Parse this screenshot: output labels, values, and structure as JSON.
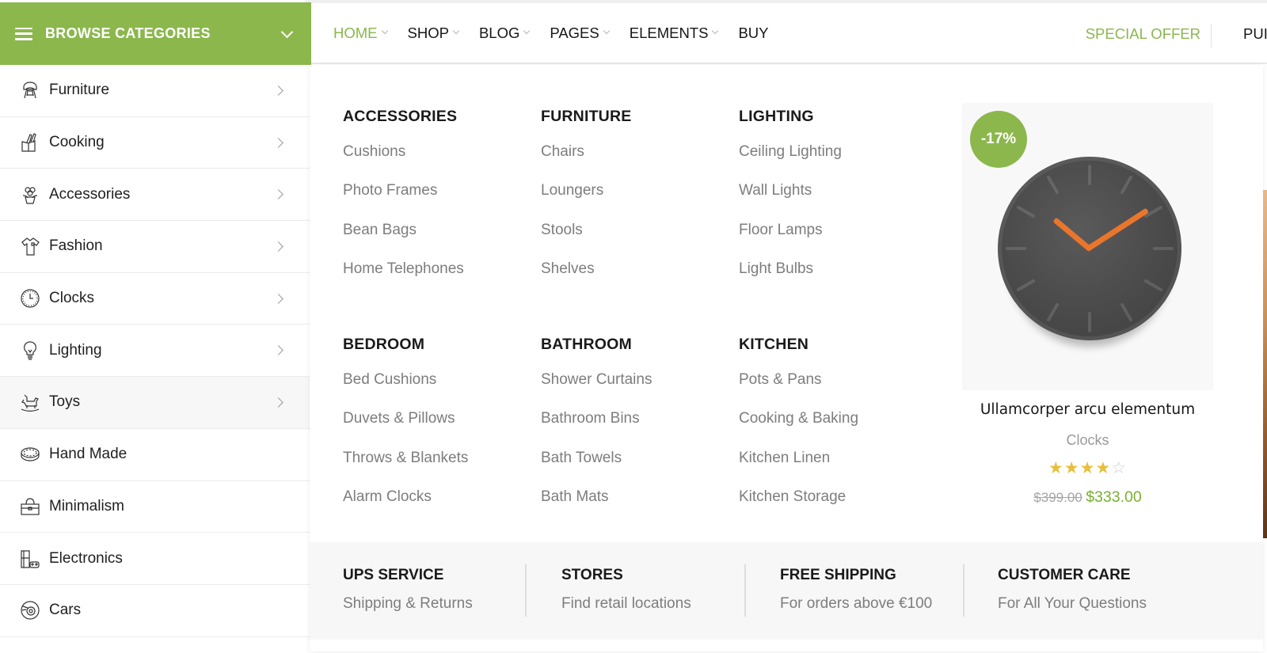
{
  "sidebar": {
    "browse_label": "BROWSE CATEGORIES",
    "categories": [
      {
        "label": "Furniture",
        "icon": "chair-icon",
        "has_submenu": true
      },
      {
        "label": "Cooking",
        "icon": "knife-block-icon",
        "has_submenu": true
      },
      {
        "label": "Accessories",
        "icon": "flower-pot-icon",
        "has_submenu": true
      },
      {
        "label": "Fashion",
        "icon": "shirt-icon",
        "has_submenu": true
      },
      {
        "label": "Clocks",
        "icon": "clock-icon",
        "has_submenu": true
      },
      {
        "label": "Lighting",
        "icon": "light-bulb-icon",
        "has_submenu": true
      },
      {
        "label": "Toys",
        "icon": "rocking-horse-icon",
        "has_submenu": true,
        "active": true
      },
      {
        "label": "Hand Made",
        "icon": "bowl-icon",
        "has_submenu": false
      },
      {
        "label": "Minimalism",
        "icon": "briefcase-icon",
        "has_submenu": false
      },
      {
        "label": "Electronics",
        "icon": "console-icon",
        "has_submenu": false
      },
      {
        "label": "Cars",
        "icon": "wheel-icon",
        "has_submenu": false
      }
    ]
  },
  "nav": {
    "items": [
      {
        "label": "HOME",
        "dropdown": true,
        "active": true
      },
      {
        "label": "SHOP",
        "dropdown": true
      },
      {
        "label": "BLOG",
        "dropdown": true
      },
      {
        "label": "PAGES",
        "dropdown": true
      },
      {
        "label": "ELEMENTS",
        "dropdown": true
      },
      {
        "label": "BUY",
        "dropdown": false
      }
    ],
    "special_offer": "SPECIAL OFFER",
    "purchase_partial": "PUI"
  },
  "mega_menu": {
    "columns": [
      {
        "title": "ACCESSORIES",
        "links": [
          "Cushions",
          "Photo Frames",
          "Bean Bags",
          "Home Telephones"
        ]
      },
      {
        "title": "FURNITURE",
        "links": [
          "Chairs",
          "Loungers",
          "Stools",
          "Shelves"
        ]
      },
      {
        "title": "LIGHTING",
        "links": [
          "Ceiling Lighting",
          "Wall Lights",
          "Floor Lamps",
          "Light Bulbs"
        ]
      },
      {
        "title": "BEDROOM",
        "links": [
          "Bed Cushions",
          "Duvets & Pillows",
          "Throws & Blankets",
          "Alarm Clocks"
        ]
      },
      {
        "title": "BATHROOM",
        "links": [
          "Shower Curtains",
          "Bathroom Bins",
          "Bath Towels",
          "Bath Mats"
        ]
      },
      {
        "title": "KITCHEN",
        "links": [
          "Pots & Pans",
          "Cooking & Baking",
          "Kitchen Linen",
          "Kitchen Storage"
        ]
      }
    ],
    "product": {
      "badge": "-17%",
      "name": "Ullamcorper arcu elementum",
      "category": "Clocks",
      "rating": 4,
      "rating_max": 5,
      "old_price": "$399.00",
      "new_price": "$333.00"
    },
    "features": [
      {
        "title": "UPS SERVICE",
        "subtitle": "Shipping & Returns"
      },
      {
        "title": "STORES",
        "subtitle": "Find retail locations"
      },
      {
        "title": "FREE SHIPPING",
        "subtitle": "For orders above €100"
      },
      {
        "title": "CUSTOMER CARE",
        "subtitle": "For All Your Questions"
      }
    ]
  },
  "colors": {
    "accent": "#8bb74c",
    "price_green": "#79b02e",
    "star": "#e8be3c",
    "clock_hands": "#e9762b"
  }
}
